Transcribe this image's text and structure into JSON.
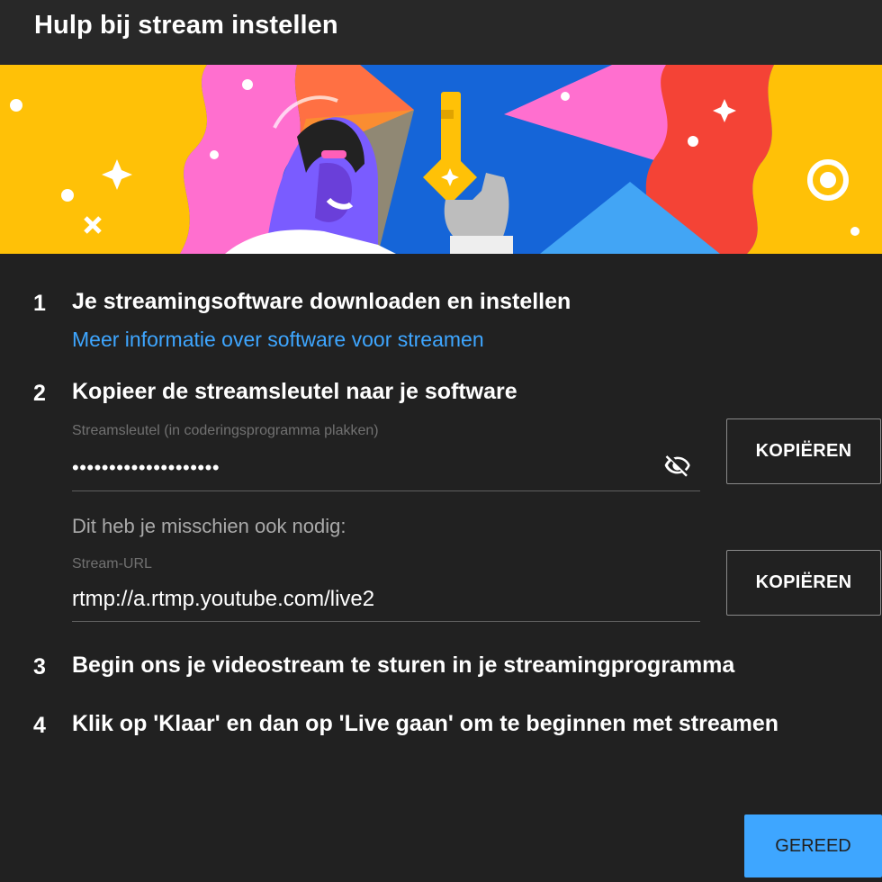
{
  "dialog": {
    "title": "Hulp bij stream instellen"
  },
  "steps": [
    {
      "number": "1",
      "text": "Je streamingsoftware downloaden en instellen",
      "link": "Meer informatie over software voor streamen"
    },
    {
      "number": "2",
      "text": "Kopieer de streamsleutel naar je software"
    },
    {
      "number": "3",
      "text": "Begin ons je videostream te sturen in je streamingprogramma"
    },
    {
      "number": "4",
      "text": "Klik op 'Klaar' en dan op 'Live gaan' om te beginnen met streamen"
    }
  ],
  "stream_key": {
    "label": "Streamsleutel (in coderingsprogramma plakken)",
    "value": "••••••••••••••••••••",
    "visibility_icon": "eye-off-icon",
    "copy_label": "KOPIËREN"
  },
  "extra_hint": "Dit heb je misschien ook nodig:",
  "stream_url": {
    "label": "Stream-URL",
    "value": "rtmp://a.rtmp.youtube.com/live2",
    "copy_label": "KOPIËREN"
  },
  "footer": {
    "done_label": "GEREED"
  },
  "colors": {
    "background": "#212121",
    "link": "#3ea6ff",
    "accent_button": "#3ea6ff"
  }
}
